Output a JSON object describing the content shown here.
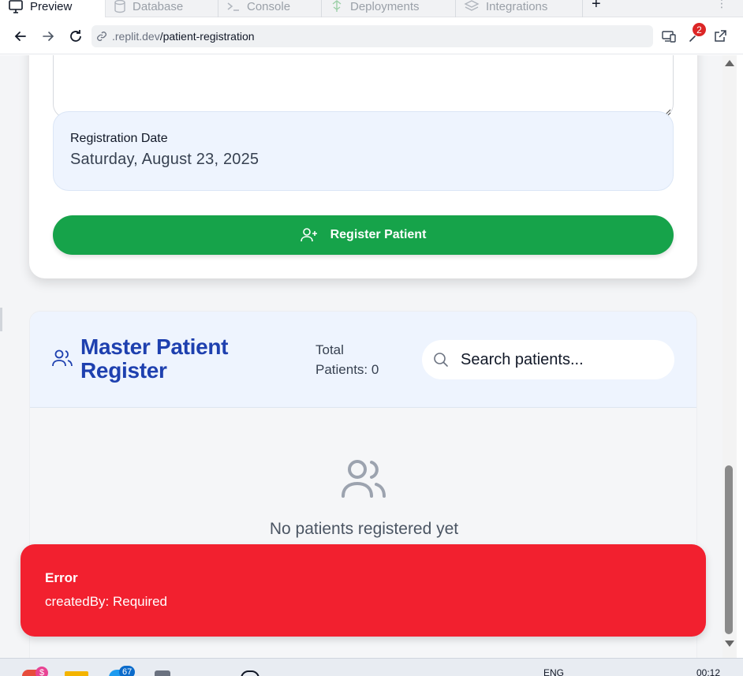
{
  "tabs": [
    {
      "label": "Preview",
      "icon": "monitor-icon",
      "active": true
    },
    {
      "label": "Database",
      "icon": "database-icon",
      "active": false
    },
    {
      "label": "Console",
      "icon": "terminal-icon",
      "active": false
    },
    {
      "label": "Deployments",
      "icon": "deploy-icon",
      "active": false
    },
    {
      "label": "Integrations",
      "icon": "layers-icon",
      "active": false
    }
  ],
  "tab_actions": {
    "new_tab": "+",
    "more": "⋮"
  },
  "address": {
    "host": ".replit.dev",
    "path": "/patient-registration",
    "notification_count": "2"
  },
  "registration": {
    "date_label": "Registration Date",
    "date_value": "Saturday, August 23, 2025",
    "register_button": "Register Patient"
  },
  "register": {
    "title": "Master Patient Register",
    "total_patients": "Total Patients: 0",
    "search_placeholder": "Search patients...",
    "empty_message": "No patients registered yet"
  },
  "toast": {
    "title": "Error",
    "message": "createdBy: Required"
  },
  "taskbar": {
    "mail_badge": "67",
    "language": "ENG",
    "time": "00:12"
  },
  "colors": {
    "primary_green": "#16a34a",
    "title_blue": "#1e40af",
    "error_red": "#f2202f",
    "date_box_bg": "#eef4fe"
  }
}
